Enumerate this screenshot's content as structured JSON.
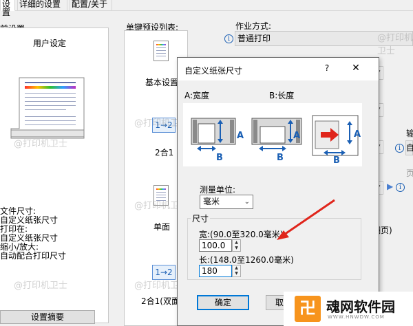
{
  "tabs": [
    {
      "label": "设置"
    },
    {
      "label": "详细的设置"
    },
    {
      "label": "配置/关于"
    }
  ],
  "left": {
    "section_label": "前设置",
    "user_setting": "用户设定",
    "doc_size_label": "文件尺寸:",
    "doc_size_value": "自定义纸张尺寸",
    "print_on_label": "打印在:",
    "print_on_value": "自定义纸张尺寸",
    "zoom_label": "缩小/放大:",
    "zoom_value": "自动配合打印尺寸",
    "summary_button": "设置摘要"
  },
  "presets": {
    "label": "单键预设列表:",
    "items": [
      {
        "label": "基本设置"
      },
      {
        "label": "2合1"
      },
      {
        "label": "单面"
      },
      {
        "label": "2合1(双面"
      }
    ],
    "twoup_glyph": "1→2"
  },
  "job": {
    "label": "作业方式:",
    "value": "普通打印"
  },
  "right_fragments": {
    "output_label": "输",
    "output_value": "自",
    "page_label": "页",
    "flip_label": "翻页)"
  },
  "watermark": "@打印机卫士",
  "dialog": {
    "title": "自定义纸张尺寸",
    "help": "?",
    "close": "✕",
    "width_header": "A:宽度",
    "length_header": "B:长度",
    "letter_a": "A",
    "letter_b": "B",
    "unit_label": "测量单位:",
    "unit_value": "毫米",
    "size_group": "尺寸",
    "width_label": "宽:(90.0至320.0毫米)",
    "width_value": "100.0",
    "length_label": "长:(148.0至1260.0毫米)",
    "length_value": "180",
    "ok_button": "确定",
    "cancel_button": "取"
  },
  "site_logo": {
    "mark": "卍",
    "name": "魂网软件园",
    "url": "WWW.HNWDW.COM"
  },
  "colors": {
    "accent": "#0078d7",
    "arrow": "#e0251b",
    "logo_orange": "#f7941d"
  }
}
